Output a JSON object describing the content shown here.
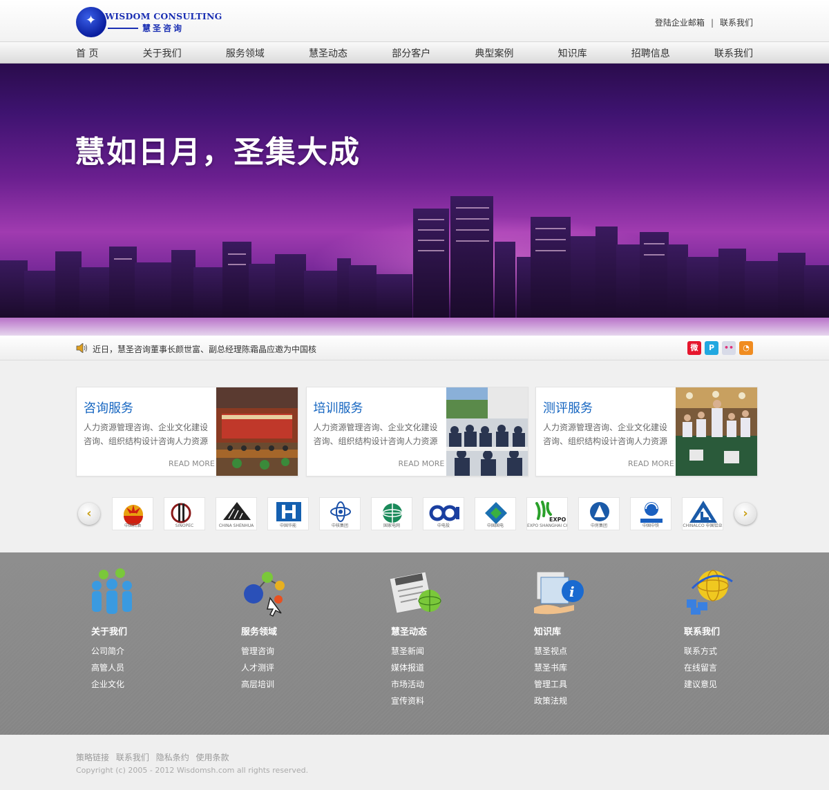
{
  "logo": {
    "en": "WISDOM CONSULTING",
    "cn": "慧圣咨询"
  },
  "top_links": {
    "mail": "登陆企业邮箱",
    "separator": "|",
    "contact": "联系我们"
  },
  "nav": [
    "首 页",
    "关于我们",
    "服务领域",
    "慧圣动态",
    "部分客户",
    "典型案例",
    "知识库",
    "招聘信息",
    "联系我们"
  ],
  "banner": {
    "title": "慧如日月，圣集大成"
  },
  "news": {
    "text": "近日，慧圣咨询董事长颜世富、副总经理陈霜晶应邀为中国核"
  },
  "social_icons": [
    {
      "name": "weibo-icon",
      "color": "#e6162d",
      "glyph": "微"
    },
    {
      "name": "pinterest-icon",
      "color": "#21a8e0",
      "glyph": "P"
    },
    {
      "name": "flickr-icon",
      "color": "#d8dbe8",
      "glyph": "••"
    },
    {
      "name": "rss-icon",
      "color": "#f08c20",
      "glyph": "◔"
    }
  ],
  "services": [
    {
      "title": "咨询服务",
      "desc": "人力资源管理咨询、企业文化建设咨询、组织结构设计咨询人力资源",
      "more": "READ MORE"
    },
    {
      "title": "培训服务",
      "desc": "人力资源管理咨询、企业文化建设咨询、组织结构设计咨询人力资源",
      "more": "READ MORE"
    },
    {
      "title": "测评服务",
      "desc": "人力资源管理咨询、企业文化建设咨询、组织结构设计咨询人力资源",
      "more": "READ MORE"
    }
  ],
  "carousel": {
    "prev": "‹",
    "next": "›",
    "logos": [
      {
        "caption": "中国石油",
        "color": "#e8a010"
      },
      {
        "caption": "SINOPEC",
        "color": "#8a1a1a"
      },
      {
        "caption": "CHINA SHENHUA",
        "color": "#222222"
      },
      {
        "caption": "中国华能",
        "color": "#1560b0"
      },
      {
        "caption": "中核集团",
        "color": "#1a50a8"
      },
      {
        "caption": "国家电网",
        "color": "#1a8a5a"
      },
      {
        "caption": "中电投",
        "color": "#1a3fa0"
      },
      {
        "caption": "中国国电",
        "color": "#1a70b0"
      },
      {
        "caption": "EXPO SHANGHAI CHINA",
        "color": "#2aa02a"
      },
      {
        "caption": "中房集团",
        "color": "#1a5aa8"
      },
      {
        "caption": "中国中铁",
        "color": "#1a60c0"
      },
      {
        "caption": "CHINALCO 中国铝业",
        "color": "#1a5aa8"
      }
    ]
  },
  "footer_cols": [
    {
      "title": "关于我们",
      "items": [
        "公司简介",
        "高管人员",
        "企业文化"
      ]
    },
    {
      "title": "服务领域",
      "items": [
        "管理咨询",
        "人才测评",
        "高层培训"
      ]
    },
    {
      "title": "慧圣动态",
      "items": [
        "慧圣新闻",
        "媒体报道",
        "市场活动",
        "宣传资料"
      ]
    },
    {
      "title": "知识库",
      "items": [
        "慧圣视点",
        "慧圣书库",
        "管理工具",
        "政策法规"
      ]
    },
    {
      "title": "联系我们",
      "items": [
        "联系方式",
        "在线留言",
        "建议意见"
      ]
    }
  ],
  "bottom": {
    "links": [
      "策略链接",
      "联系我们",
      "隐私条约",
      "使用条款"
    ],
    "copyright": "Copyright (c) 2005 - 2012  Wisdomsh.com all rights reserved."
  }
}
